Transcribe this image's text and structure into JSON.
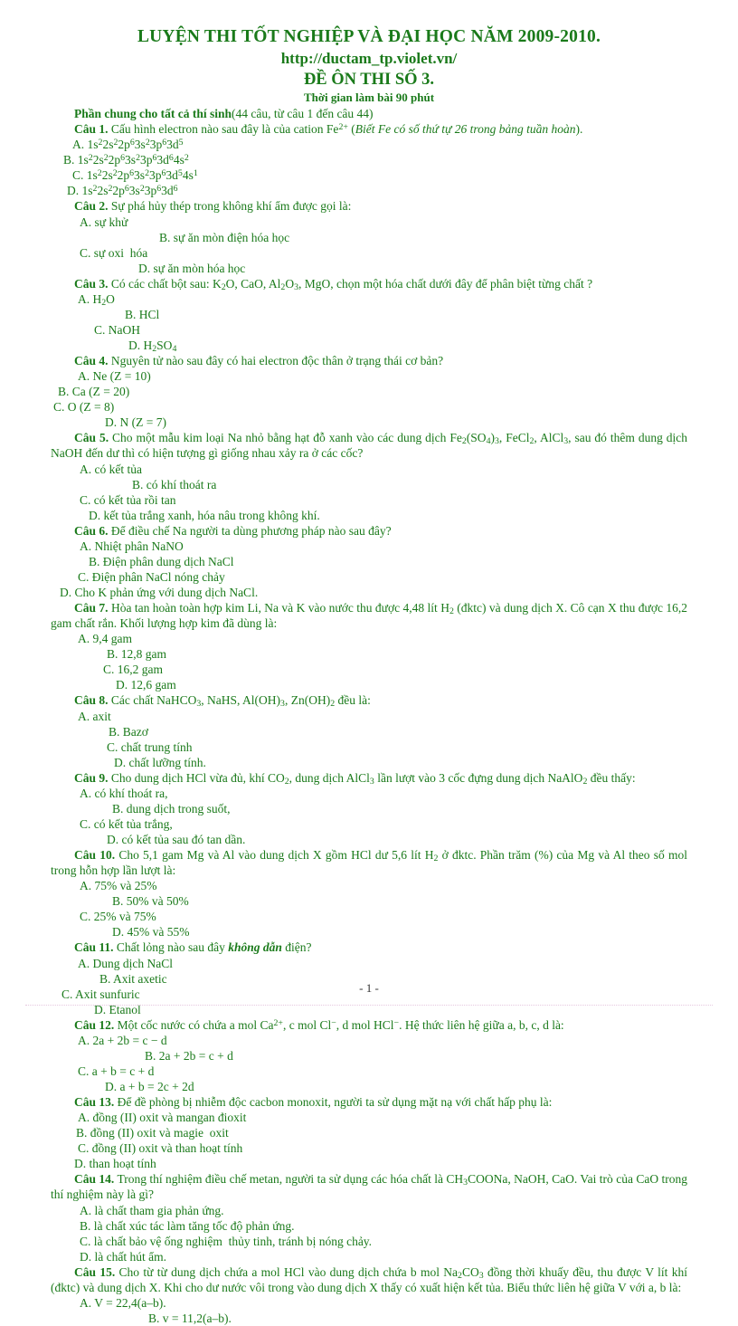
{
  "header": {
    "title": "LUYỆN THI TỐT NGHIỆP VÀ ĐẠI HỌC NĂM 2009-2010.",
    "url": "http://ductam_tp.violet.vn/",
    "subtitle": "ĐỀ ÔN THI SỐ 3.",
    "duration": "Thời gian làm bài 90 phút",
    "color": "#1a7a1a"
  },
  "section": {
    "label": "Phần chung cho tất cả thí sinh",
    "note": "(44 câu, từ câu 1 đến câu 44)"
  },
  "questions": [
    {
      "num": "Câu 1.",
      "text_html": "Cấu hình electron nào sau đây là của cation Fe<sup>2+</sup> (<i>Biết Fe có số thứ tự 26 trong bảng tuần hoàn</i>).",
      "options": [
        {
          "a_html": "A. 1s<sup>2</sup>2s<sup>2</sup>2p<sup>6</sup>3s<sup>2</sup>3p<sup>6</sup>3d<sup>5</sup>",
          "b_html": "B. 1s<sup>2</sup>2s<sup>2</sup>2p<sup>6</sup>3s<sup>2</sup>3p<sup>6</sup>3d<sup>6</sup>4s<sup>2</sup>",
          "a_pad": 24,
          "gap": 14
        },
        {
          "a_html": "C. 1s<sup>2</sup>2s<sup>2</sup>2p<sup>6</sup>3s<sup>2</sup>3p<sup>6</sup>3d<sup>5</sup>4s<sup>1</sup>",
          "b_html": "D. 1s<sup>2</sup>2s<sup>2</sup>2p<sup>6</sup>3s<sup>2</sup>3p<sup>6</sup>3d<sup>6</sup>",
          "a_pad": 24,
          "gap": 18
        }
      ]
    },
    {
      "num": "Câu 2.",
      "text_html": "Sự phá hủy thép trong không khí ẩm được gọi là:",
      "options": [
        {
          "a_html": "A. sự khử",
          "b_html": "B. sự ăn mòn điện hóa học",
          "a_pad": 32,
          "gap": 120
        },
        {
          "a_html": "C. sự oxi  hóa",
          "b_html": "D. sự ăn mòn hóa học",
          "a_pad": 32,
          "gap": 97
        }
      ]
    },
    {
      "num": "Câu 3.",
      "text_html": "Có các chất bột sau: K<sub>2</sub>O, CaO, Al<sub>2</sub>O<sub>3</sub>, MgO, chọn một hóa chất dưới đây để phân biệt từng chất ?",
      "options": [
        {
          "cols": [
            "A. H<sub>2</sub>O",
            "B. HCl",
            "C. NaOH",
            "D. H<sub>2</sub>SO<sub>4</sub>"
          ],
          "pads": [
            30,
            82,
            48,
            86
          ]
        }
      ]
    },
    {
      "num": "Câu 4.",
      "text_html": "Nguyên tử nào sau đây có hai electron độc thân ở trạng thái cơ bản?",
      "options": [
        {
          "cols": [
            "A. Ne (Z = 10)",
            "B. Ca (Z = 20)",
            "C. O (Z = 8)",
            "D. N (Z = 7)"
          ],
          "pads": [
            30,
            8,
            3,
            60
          ]
        }
      ]
    },
    {
      "num": "Câu 5.",
      "text_html": "Cho một mẫu kim loại  Na nhỏ bằng hạt đỗ xanh vào các dung dịch Fe<sub>2</sub>(SO<sub>4</sub>)<sub>3</sub>, FeCl<sub>2</sub>, AlCl<sub>3</sub>, sau đó thêm dung dịch NaOH đến dư thì có hiện tượng gì giống nhau xảy ra ở các cốc?",
      "options": [
        {
          "a_html": "A. có kết tủa",
          "b_html": "B. có khí thoát ra",
          "a_pad": 32,
          "gap": 90
        },
        {
          "a_html": "C. có kết tủa rồi tan",
          "b_html": "D. kết tủa trắng xanh, hóa nâu trong không khí.",
          "a_pad": 32,
          "gap": 42
        }
      ]
    },
    {
      "num": "Câu 6.",
      "text_html": " Để điều chế Na người ta dùng phương pháp nào sau đây?",
      "options": [
        {
          "a_html": "A. Nhiệt phân NaNO",
          "b_html": "B. Điện phân dung dịch NaCl",
          "a_pad": 32,
          "gap": 42
        },
        {
          "a_html": "C. Điện phân NaCl nóng chảy",
          "b_html": "D. Cho K phản ứng với dung dịch NaCl.",
          "a_pad": 30,
          "gap": 10
        }
      ]
    },
    {
      "num": "Câu 7.",
      "text_html": " Hòa tan hoàn toàn hợp kim Li, Na và K vào nước thu được 4,48 lít H<sub>2</sub> (đktc) và dung dịch X. Cô cạn X thu được 16,2 gam chất rắn. Khối lượng hợp kim đã dùng là:",
      "options": [
        {
          "cols": [
            "A. 9,4 gam",
            "B. 12,8 gam",
            "C. 16,2 gam",
            "D. 12,6 gam"
          ],
          "pads": [
            30,
            62,
            58,
            72
          ]
        }
      ]
    },
    {
      "num": "Câu 8.",
      "text_html": "Các chất NaHCO<sub>3</sub>, NaHS, Al(OH)<sub>3</sub>, Zn(OH)<sub>2</sub> đều là:",
      "options": [
        {
          "cols": [
            "A. axit",
            "B. Bazơ",
            "C. chất trung tính",
            "D. chất lưỡng tính."
          ],
          "pads": [
            30,
            64,
            62,
            70
          ]
        }
      ]
    },
    {
      "num": "Câu 9.",
      "text_html": " Cho dung dịch HCl vừa đủ, khí CO<sub>2</sub>, dung dịch AlCl<sub>3</sub> lần lượt vào 3 cốc đựng dung dịch NaAlO<sub>2</sub> đều thấy:",
      "options": [
        {
          "a_html": "A. có khí thoát ra,",
          "b_html": "B. dung dịch trong suốt,",
          "a_pad": 32,
          "gap": 68
        },
        {
          "a_html": "C. có kết tủa trắng,",
          "b_html": "D. có kết tủa sau đó tan dần.",
          "a_pad": 32,
          "gap": 62
        }
      ]
    },
    {
      "num": "Câu 10.",
      "text_html": " Cho 5,1 gam Mg và Al vào dung dịch X gồm HCl dư 5,6 lít H<sub>2</sub> ở đktc. Phần trăm (%) của Mg và Al theo số mol trong hỗn hợp lần lượt là:",
      "options": [
        {
          "a_html": "A. 75% và 25%",
          "b_html": "B. 50% và 50%",
          "a_pad": 32,
          "gap": 68
        },
        {
          "a_html": "C. 25% và 75%",
          "b_html": "D. 45% và 55%",
          "a_pad": 32,
          "gap": 68
        }
      ]
    },
    {
      "num": "Câu 11.",
      "text_html": " Chất lỏng nào sau đây <b class=\"bi\">không dẫn</b> điện?",
      "options": [
        {
          "cols": [
            "A. Dung dịch NaCl",
            "B. Axit axetic",
            "C. Axit sunfuric",
            "D. Etanol"
          ],
          "pads": [
            30,
            54,
            12,
            48
          ]
        }
      ]
    },
    {
      "num": "Câu 12.",
      "text_html": " Một cốc nước có chứa a mol Ca<sup>2+</sup>, c mol Cl<sup>−</sup>, d mol HCl<sup>−</sup>. Hệ thức liên hệ giữa a, b, c, d là:",
      "options": [
        {
          "a_html": "A. 2a + 2b = c − d",
          "b_html": "B. 2a + 2b = c + d",
          "a_pad": 30,
          "gap": 104
        },
        {
          "a_html": "C. a + b = c + d",
          "b_html": "D. a + b = 2c + 2d",
          "a_pad": 30,
          "gap": 60
        }
      ]
    },
    {
      "num": "Câu 13.",
      "text_html": " Để đề phòng bị nhiễm  độc cacbon monoxit, người ta sử dụng mặt nạ với chất hấp phụ là:",
      "options": [
        {
          "a_html": "A. đồng (II) oxit và mangan đioxit",
          "b_html": "B. đồng (II) oxit và magie  oxit",
          "a_pad": 30,
          "gap": 28
        },
        {
          "a_html": "C. đồng (II) oxit và than hoạt tính",
          "b_html": "D. than hoạt tính",
          "a_pad": 30,
          "gap": 26
        }
      ]
    },
    {
      "num": "Câu 14.",
      "text_html": " Trong thí nghiệm  điều chế metan, người ta sử dụng các hóa chất là CH<sub>3</sub>COONa, NaOH, CaO. Vai trò của CaO trong thí nghiệm  này là gì?",
      "options": [
        {
          "single": "A. là chất tham gia phản ứng."
        },
        {
          "single": "B. là chất xúc tác làm tăng tốc độ phản ứng."
        },
        {
          "single": "C. là chất bảo vệ ống nghiệm  thủy tinh, tránh bị nóng chảy."
        },
        {
          "single": "D. là chất hút ẩm."
        }
      ]
    },
    {
      "num": "Câu 15.",
      "text_html": " Cho từ từ dung dịch chứa a mol HCl vào dung dịch chứa b mol Na<sub>2</sub>CO<sub>3</sub> đồng thời khuấy đều, thu được V lít khí (đktc) và dung dịch X. Khi cho dư nước vôi trong vào dung dịch X thấy có xuất hiện kết tủa. Biểu thức liên hệ giữa V với a, b là:",
      "options": [
        {
          "a_html": "A. V = 22,4(a–b).",
          "b_html": "B. v = 11,2(a–b).",
          "a_pad": 32,
          "gap": 108
        }
      ]
    }
  ],
  "footer": {
    "page_number": "- 1 -"
  }
}
